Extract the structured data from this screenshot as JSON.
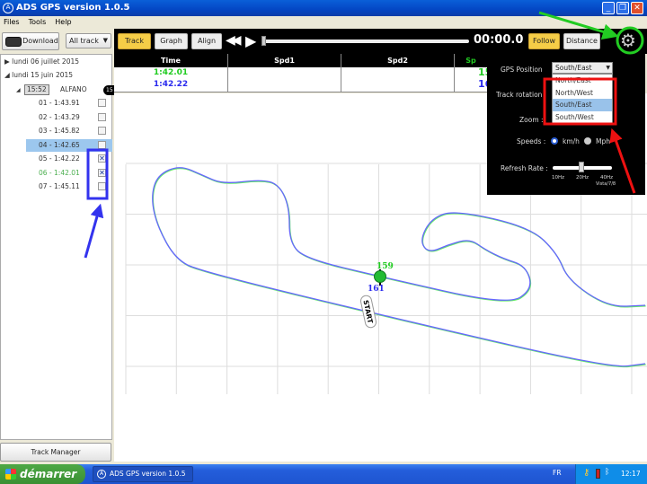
{
  "window": {
    "title": "ADS GPS version 1.0.5",
    "icon": "ads-logo-icon"
  },
  "menu": [
    "Files",
    "Tools",
    "Help"
  ],
  "left": {
    "download_label": "Download",
    "filter_value": "All track",
    "tree": [
      {
        "label": "lundi 06 juillet 2015",
        "expanded": false
      },
      {
        "label": "lundi 15 juin 2015",
        "expanded": true
      }
    ],
    "session": {
      "time": "15:52",
      "name": "ALFANO",
      "badge": "15"
    },
    "laps": [
      {
        "label": "01 - 1:43.91",
        "checked": false,
        "selected": false,
        "color": "#333333"
      },
      {
        "label": "02 - 1:43.29",
        "checked": false,
        "selected": false,
        "color": "#333333"
      },
      {
        "label": "03 - 1:45.82",
        "checked": false,
        "selected": false,
        "color": "#333333"
      },
      {
        "label": "04 - 1:42.65",
        "checked": false,
        "selected": true,
        "color": "#333333"
      },
      {
        "label": "05 - 1:42.22",
        "checked": true,
        "selected": false,
        "color": "#333333"
      },
      {
        "label": "06 - 1:42.01",
        "checked": true,
        "selected": false,
        "color": "#4caf50"
      },
      {
        "label": "07 - 1:45.11",
        "checked": false,
        "selected": false,
        "color": "#333333"
      }
    ],
    "track_manager_label": "Track Manager"
  },
  "toolbar": {
    "track": "Track",
    "graph": "Graph",
    "align": "Align",
    "time": "00:00.0",
    "follow": "Follow",
    "distance": "Distance",
    "active": "Track",
    "playback_progress": 0
  },
  "table": {
    "headers": [
      "Time",
      "Spd1",
      "Spd2",
      "Sp"
    ],
    "rows": [
      {
        "time": "1:42.01",
        "spd3": "15",
        "color": "#22cc22"
      },
      {
        "time": "1:42.22",
        "spd3": "16",
        "color": "#2a2aee"
      }
    ]
  },
  "map": {
    "marker_green": "159",
    "marker_blue": "161",
    "start_label": "START",
    "colors": {
      "lap_green": "#66ee66",
      "lap_blue": "#6666ff"
    }
  },
  "settings": {
    "gps_position_label": "GPS Position",
    "gps_position_value": "South/East",
    "gps_options": [
      "North/East",
      "North/West",
      "South/East",
      "South/West"
    ],
    "track_rotation_label": "Track rotation :",
    "zoom_label": "Zoom :",
    "speeds_label": "Speeds :",
    "speed_options": [
      "km/h",
      "Mph"
    ],
    "speed_selected": "km/h",
    "refresh_label": "Refresh Rate :",
    "refresh_ticks": [
      "10Hz",
      "20Hz",
      "40Hz"
    ],
    "refresh_note": "Vista/7/8",
    "refresh_value": "20Hz"
  },
  "taskbar": {
    "start": "démarrer",
    "task": "ADS GPS version 1.0.5",
    "lang": "FR",
    "clock": "12:17"
  }
}
